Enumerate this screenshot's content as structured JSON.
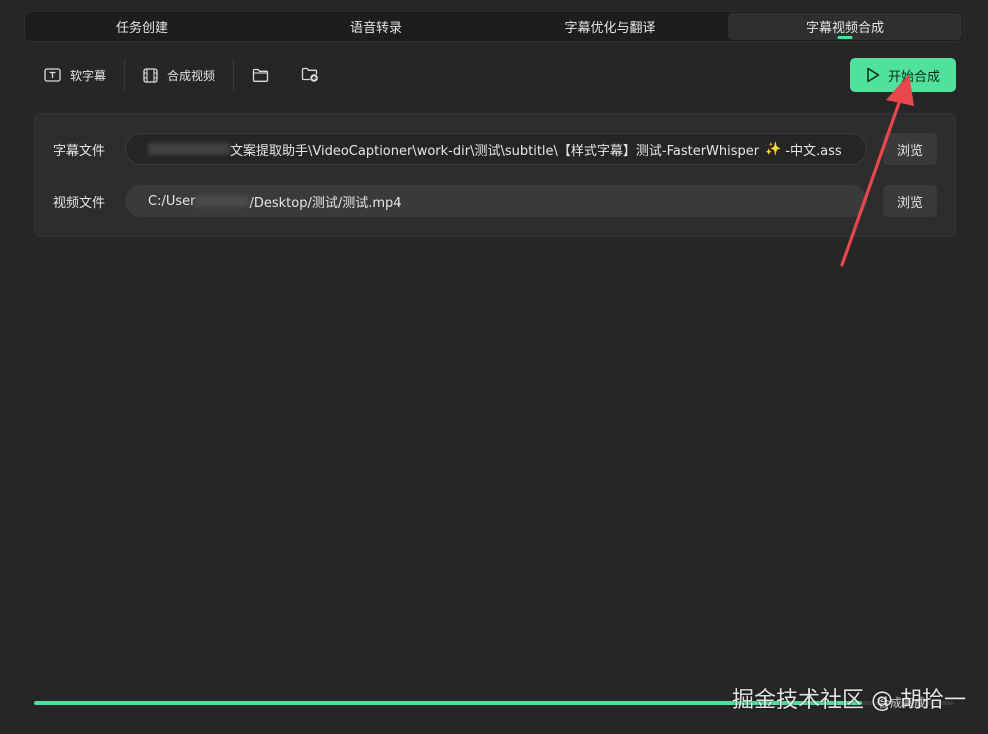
{
  "tabs": [
    {
      "label": "任务创建",
      "active": false
    },
    {
      "label": "语音转录",
      "active": false
    },
    {
      "label": "字幕优化与翻译",
      "active": false
    },
    {
      "label": "字幕视频合成",
      "active": true
    }
  ],
  "toolbar": {
    "soft_subtitle_label": "软字幕",
    "merge_video_label": "合成视频",
    "open_folder_icon": "folder-icon",
    "add_folder_icon": "folder-plus-icon"
  },
  "start_button": {
    "label": "开始合成",
    "icon": "play-icon"
  },
  "subtitle_file": {
    "label": "字幕文件",
    "path_visible": "文案提取助手\\VideoCaptioner\\work-dir\\测试\\subtitle\\【样式字幕】测试-FasterWhisper",
    "path_suffix": "-中文.ass",
    "sparkle": "✨"
  },
  "video_file": {
    "label": "视频文件",
    "path_prefix": "C:/User",
    "path_suffix": "/Desktop/测试/测试.mp4"
  },
  "browse_label": "浏览",
  "progress": {
    "fraction": 0.9,
    "status": "合成完成"
  },
  "watermark": "掘金技术社区 @ 胡拾一",
  "colors": {
    "accent": "#4ee29c",
    "background": "#262626",
    "annotation": "#e8484d"
  }
}
